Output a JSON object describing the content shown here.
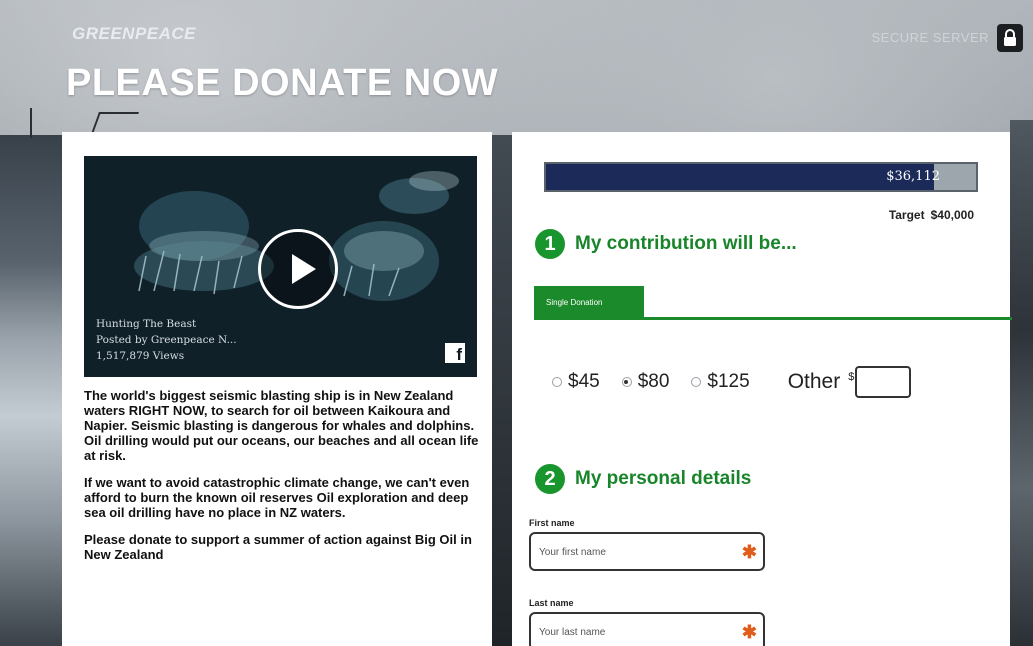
{
  "header": {
    "brand": "GREENPEACE",
    "headline": "PLEASE DONATE NOW",
    "secure_label": "SECURE SERVER"
  },
  "video": {
    "title": "Hunting The Beast",
    "posted_by": "Posted by Greenpeace N...",
    "views": "1,517,879 Views"
  },
  "intro": {
    "paragraphs": [
      "The world's biggest seismic blasting ship is in New Zealand waters RIGHT NOW, to search for oil between Kaikoura and Napier. Seismic blasting is dangerous for whales and dolphins. Oil drilling would put our oceans, our beaches and all ocean life at risk.",
      "If we want to avoid catastrophic climate change, we can't even afford to burn the known oil reserves Oil exploration and deep sea oil drilling have no place in NZ waters.",
      "Please donate to support a summer of action against Big Oil in New Zealand"
    ]
  },
  "progress": {
    "raised": "$36,112",
    "target_label": "Target",
    "target_amount": "$40,000",
    "fraction": 0.9028
  },
  "step1": {
    "number": "1",
    "title": "My contribution will be..."
  },
  "tabs": {
    "single": "Single Donation"
  },
  "amounts": {
    "options": [
      "$45",
      "$80",
      "$125"
    ],
    "selected": "$80",
    "other_label": "Other",
    "currency": "$"
  },
  "step2": {
    "number": "2",
    "title": "My personal details"
  },
  "form": {
    "first_name_label": "First name",
    "first_name_placeholder": "Your first name",
    "last_name_label": "Last name",
    "last_name_placeholder": "Your last name"
  },
  "colors": {
    "accent_green": "#19952e",
    "progress_navy": "#1b2a58",
    "required_orange": "#e05c1a"
  }
}
